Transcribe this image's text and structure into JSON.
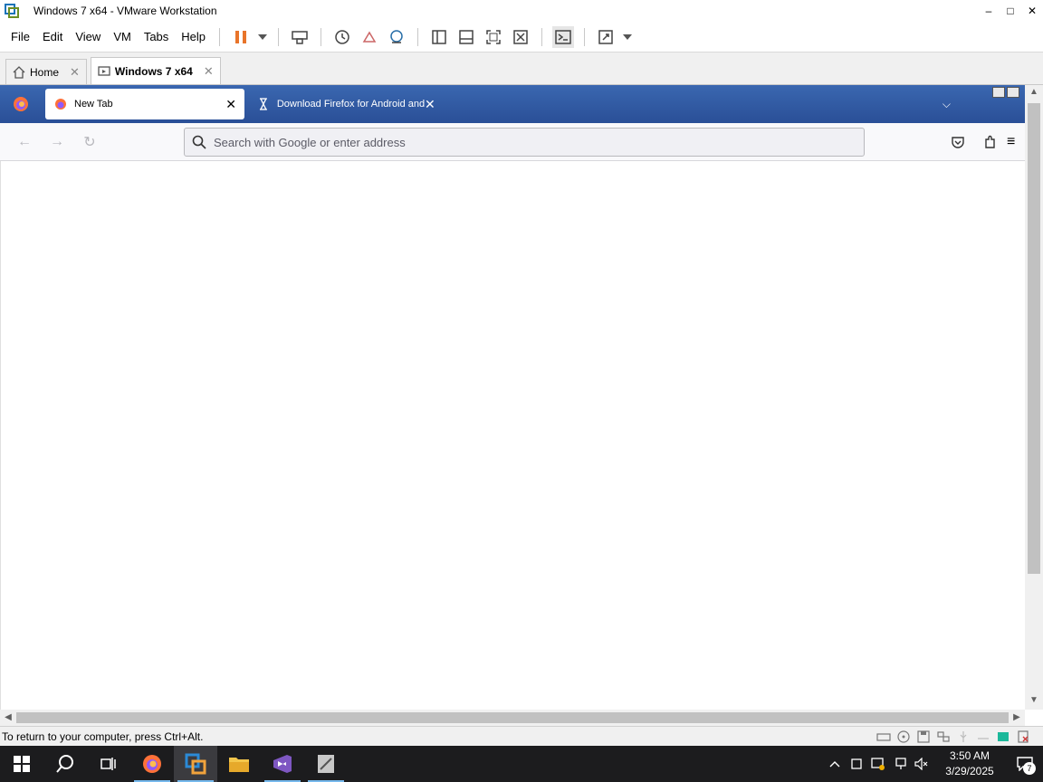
{
  "window": {
    "title": "Windows 7 x64 - VMware Workstation",
    "minimize": "–",
    "maximize": "□",
    "close": "✕"
  },
  "menu": {
    "items": [
      "File",
      "Edit",
      "View",
      "VM",
      "Tabs",
      "Help"
    ]
  },
  "vm_tabs": {
    "home_label": "Home",
    "vm_label": "Windows 7 x64",
    "close": "✕"
  },
  "firefox": {
    "tabs": [
      {
        "label": "New Tab",
        "active": true
      },
      {
        "label": "Download Firefox for Android and",
        "active": false
      }
    ],
    "tab_close": "✕",
    "list_all_tabs": "⌵",
    "nav": {
      "back": "←",
      "forward": "→",
      "reload": "↻"
    },
    "urlbar": {
      "placeholder": "Search with Google or enter address",
      "value": ""
    },
    "menu_icon": "≡"
  },
  "statusbar": {
    "text": "To return to your computer, press Ctrl+Alt."
  },
  "taskbar": {
    "time": "3:50 AM",
    "date": "3/29/2025",
    "notification_count": "7"
  },
  "colors": {
    "firefox_tabstrip": "#2f5aa4",
    "taskbar": "#1c1c1e",
    "pause_orange": "#e8742a"
  }
}
